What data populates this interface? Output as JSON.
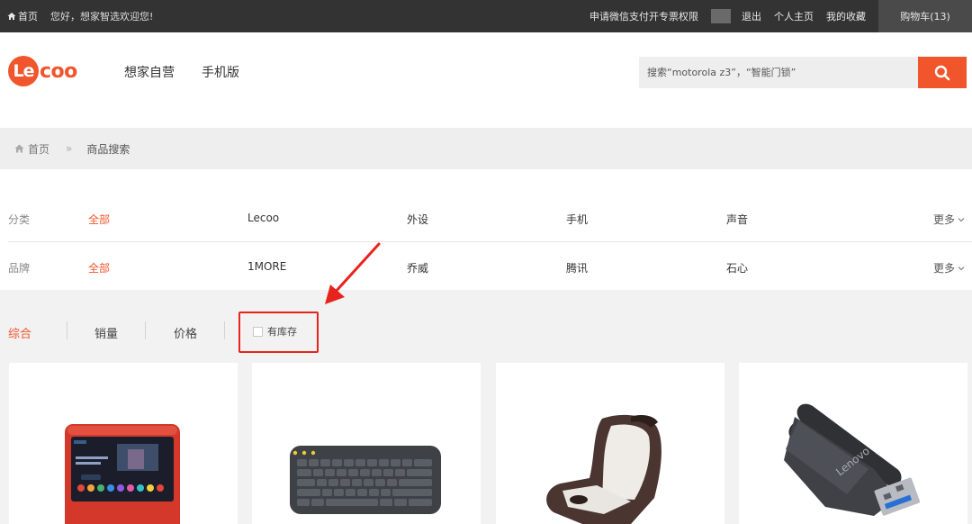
{
  "topbar": {
    "home_label": "首页",
    "greeting": "您好，想家智选欢迎您!",
    "links": [
      "申请微信支付开专票权限",
      "退出",
      "个人主页",
      "我的收藏"
    ],
    "cart_label": "购物车(13)"
  },
  "header": {
    "logo_letter": "Le",
    "logo_rest": "coo",
    "nav": [
      "想家自营",
      "手机版"
    ],
    "search_placeholder": "搜索“motorola z3”，“智能门锁”"
  },
  "breadcrumb": {
    "home": "首页",
    "separator": "»",
    "current": "商品搜索"
  },
  "filters": {
    "category": {
      "label": "分类",
      "options": [
        "全部",
        "Lecoo",
        "外设",
        "手机",
        "声音"
      ],
      "more": "更多"
    },
    "brand": {
      "label": "品牌",
      "options": [
        "全部",
        "1MORE",
        "乔威",
        "腾讯",
        "石心"
      ],
      "more": "更多"
    }
  },
  "sort": {
    "options": [
      "综合",
      "销量",
      "价格"
    ],
    "active_index": 0,
    "in_stock_label": "有库存",
    "in_stock_checked": false
  },
  "products": [
    {
      "icon": "smart-speaker-image"
    },
    {
      "icon": "keyboard-image"
    },
    {
      "icon": "massage-chair-image"
    },
    {
      "icon": "usb-drive-image"
    }
  ],
  "colors": {
    "accent": "#f0552b",
    "annotation": "#e8231d",
    "topbar": "#333333"
  }
}
